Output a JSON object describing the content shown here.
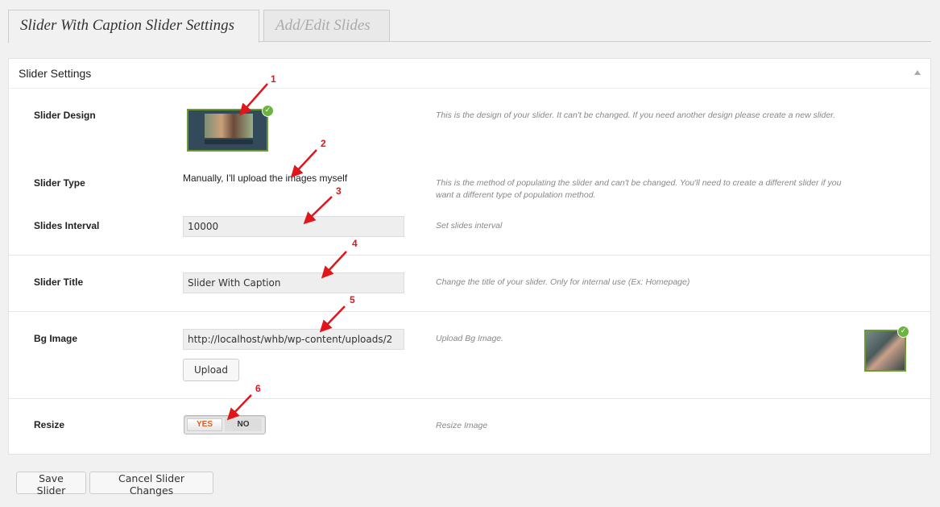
{
  "tabs": [
    {
      "label": "Slider With Caption Slider Settings",
      "active": true
    },
    {
      "label": "Add/Edit Slides",
      "active": false
    }
  ],
  "panel": {
    "title": "Slider Settings",
    "rows": {
      "design": {
        "label": "Slider Design",
        "description": "This is the design of your slider. It can't be changed. If you need another design please create a new slider."
      },
      "type": {
        "label": "Slider Type",
        "value": "Manually, I'll upload the images myself",
        "description": "This is the method of populating the slider and can't be changed. You'll need to create a different slider if you want a different type of population method."
      },
      "interval": {
        "label": "Slides Interval",
        "value": "10000",
        "description": "Set slides interval"
      },
      "title": {
        "label": "Slider Title",
        "value": "Slider With Caption",
        "description": "Change the title of your slider. Only for internal use (Ex: Homepage)"
      },
      "bg_image": {
        "label": "Bg Image",
        "value": "http://localhost/whb/wp-content/uploads/2",
        "upload_label": "Upload",
        "description": "Upload Bg Image."
      },
      "resize": {
        "label": "Resize",
        "yes_label": "YES",
        "no_label": "NO",
        "selected": "YES",
        "description": "Resize Image"
      }
    }
  },
  "annotations": [
    "1",
    "2",
    "3",
    "4",
    "5",
    "6"
  ],
  "footer": {
    "save_label": "Save Slider",
    "cancel_label": "Cancel Slider Changes"
  },
  "colors": {
    "annotation": "#e0161a",
    "accent_border": "#6a9b2e",
    "check": "#6cb33f",
    "yes_text": "#e25a1c"
  }
}
